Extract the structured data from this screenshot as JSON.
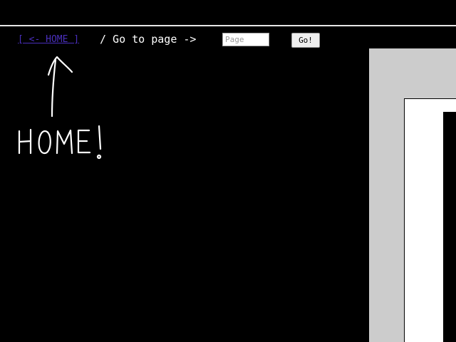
{
  "nav": {
    "home_link": "[ <- HOME ]",
    "separator": "/ Go to page ->",
    "page_placeholder": "Page",
    "go_label": "Go!"
  },
  "annotation": {
    "label": "HOME!",
    "arrow_icon": "hand-drawn-up-arrow-icon"
  },
  "colors": {
    "background": "#000000",
    "link": "#4a2fbd",
    "text": "#ffffff",
    "panel_gray": "#cccccc"
  }
}
